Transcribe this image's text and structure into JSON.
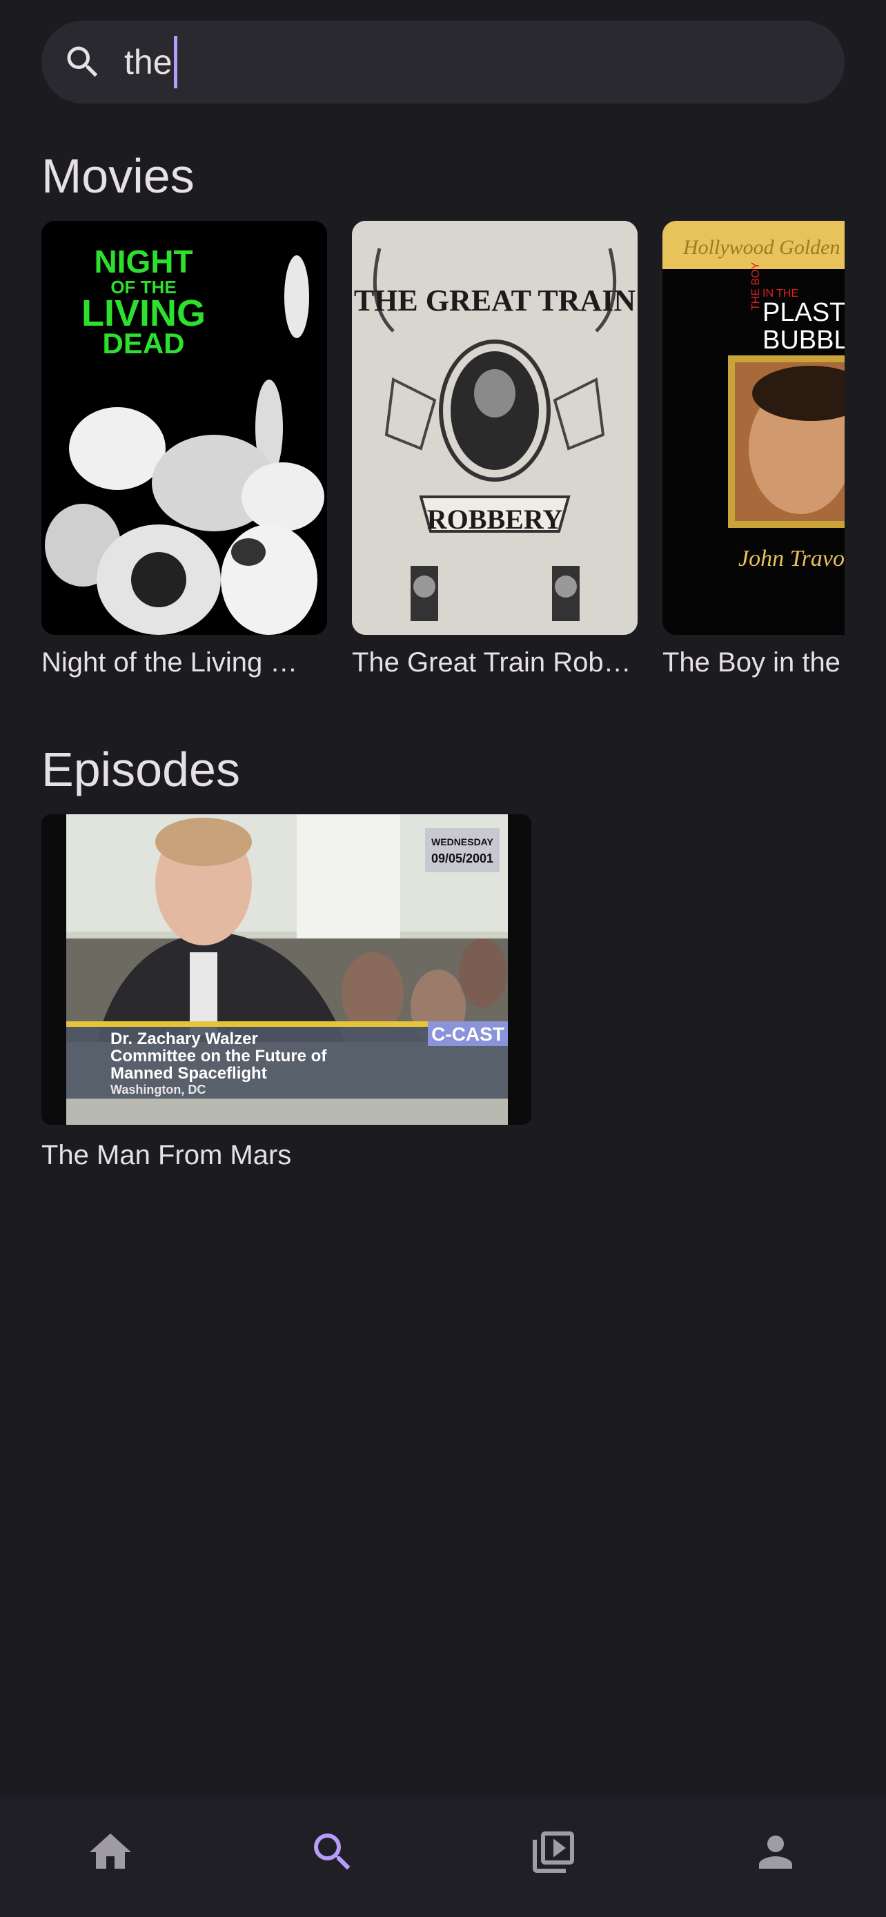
{
  "search": {
    "query": "the"
  },
  "sections": {
    "movies": "Movies",
    "episodes": "Episodes"
  },
  "movies": [
    {
      "title": "Night of the Living …",
      "poster_text": [
        "NIGHT",
        "OF THE",
        "LIVING",
        "DEAD"
      ]
    },
    {
      "title": "The Great Train Rob…",
      "poster_text": [
        "THE GREAT TRAIN",
        "ROBBERY"
      ]
    },
    {
      "title": "The Boy in the",
      "poster_text": [
        "Hollywood Golden",
        "THE BOY",
        "IN THE",
        "PLASTIC",
        "BUBBLE",
        "John Travo"
      ]
    }
  ],
  "episodes": [
    {
      "title": "The Man From Mars",
      "thumb_text": {
        "date_day": "WEDNESDAY",
        "date": "09/05/2001",
        "network": "C-CAST",
        "lower_third": [
          "Dr. Zachary Walzer",
          "Committee on the Future of",
          "Manned Spaceflight"
        ],
        "location": "Washington, DC"
      }
    }
  ],
  "nav": {
    "items": [
      "home-icon",
      "search-icon",
      "video-library-icon",
      "account-icon"
    ],
    "active": "search-icon"
  },
  "colors": {
    "background": "#1c1b1f",
    "accent": "#b69df8",
    "surface": "#2b2930",
    "nav_bg": "#211f26"
  }
}
